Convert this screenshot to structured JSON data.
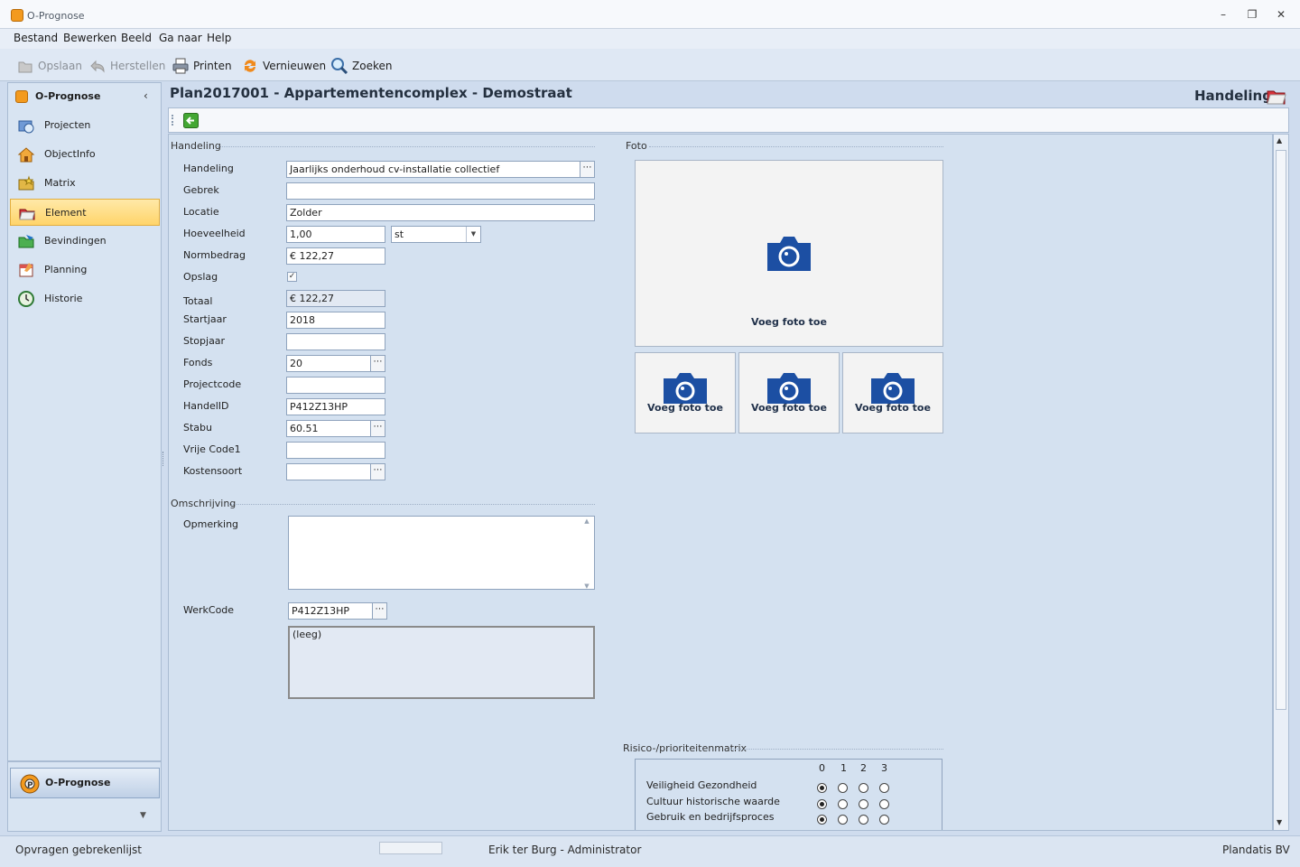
{
  "window": {
    "title": "O-Prognose"
  },
  "menu": [
    "Bestand",
    "Bewerken",
    "Beeld",
    "Ga naar",
    "Help"
  ],
  "toolbar": {
    "save": "Opslaan",
    "restore": "Herstellen",
    "print": "Printen",
    "refresh": "Vernieuwen",
    "search": "Zoeken"
  },
  "sidebar": {
    "title": "O-Prognose",
    "items": [
      {
        "label": "Projecten",
        "icon": "projects-icon"
      },
      {
        "label": "ObjectInfo",
        "icon": "house-icon"
      },
      {
        "label": "Matrix",
        "icon": "folder-star-icon"
      },
      {
        "label": "Element",
        "icon": "folder-red-icon"
      },
      {
        "label": "Bevindingen",
        "icon": "folder-green-icon"
      },
      {
        "label": "Planning",
        "icon": "calendar-icon"
      },
      {
        "label": "Historie",
        "icon": "history-icon"
      }
    ],
    "selected": "Element",
    "bottom_label": "O-Prognose"
  },
  "header": {
    "title": "Plan2017001 - Appartementencomplex - Demostraat",
    "section": "Handeling"
  },
  "form": {
    "group_handeling": "Handeling",
    "group_foto": "Foto",
    "group_omschrijving": "Omschrijving",
    "group_risico": "Risico-/prioriteitenmatrix",
    "fields": {
      "handeling": {
        "label": "Handeling",
        "value": "Jaarlijks onderhoud cv-installatie collectief"
      },
      "gebrek": {
        "label": "Gebrek",
        "value": ""
      },
      "locatie": {
        "label": "Locatie",
        "value": "Zolder"
      },
      "hoeveelheid": {
        "label": "Hoeveelheid",
        "value": "1,00",
        "unit": "st"
      },
      "normbedrag": {
        "label": "Normbedrag",
        "value": "€ 122,27"
      },
      "opslag": {
        "label": "Opslag",
        "checked": true
      },
      "totaal": {
        "label": "Totaal",
        "value": "€ 122,27"
      },
      "startjaar": {
        "label": "Startjaar",
        "value": "2018"
      },
      "stopjaar": {
        "label": "Stopjaar",
        "value": ""
      },
      "fonds": {
        "label": "Fonds",
        "value": "20"
      },
      "projectcode": {
        "label": "Projectcode",
        "value": ""
      },
      "handelid": {
        "label": "HandelID",
        "value": "P412Z13HP"
      },
      "stabu": {
        "label": "Stabu",
        "value": "60.51"
      },
      "vrijecode1": {
        "label": "Vrije Code1",
        "value": ""
      },
      "kostensoort": {
        "label": "Kostensoort",
        "value": ""
      },
      "opmerking": {
        "label": "Opmerking",
        "value": ""
      },
      "werkcode": {
        "label": "WerkCode",
        "value": "P412Z13HP",
        "memo": "(leeg)"
      }
    },
    "photos": {
      "add_label": "Voeg foto toe"
    },
    "risk": {
      "columns": [
        "0",
        "1",
        "2",
        "3"
      ],
      "rows": [
        {
          "label": "Veiligheid  Gezondheid",
          "selected": 0
        },
        {
          "label": "Cultuur historische waarde",
          "selected": 0
        },
        {
          "label": "Gebruik en bedrijfsproces",
          "selected": 0
        }
      ]
    }
  },
  "status": {
    "left": "Opvragen gebrekenlijst",
    "user": "Erik ter Burg - Administrator",
    "company": "Plandatis BV"
  }
}
